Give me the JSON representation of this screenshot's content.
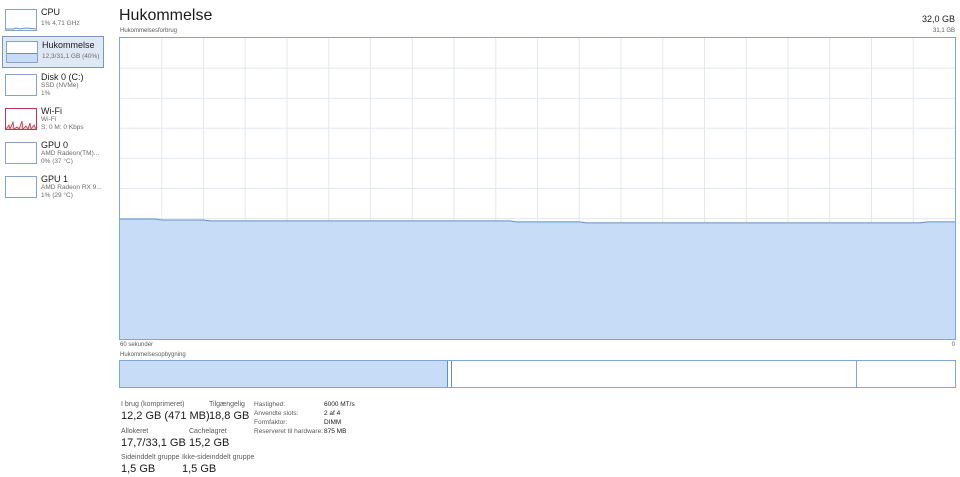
{
  "colors": {
    "memory_fill": "#c7dcf6",
    "memory_line": "#5f8fcf",
    "graph_border": "#7ea7d8",
    "grid": "#e3e8ef",
    "wifi_accent": "#c0354e"
  },
  "sidebar": {
    "items": [
      {
        "title": "CPU",
        "sub1": "1% 4,71 GHz",
        "sub2": "",
        "icon": "cpu-mini-graph"
      },
      {
        "title": "Hukommelse",
        "sub1": "12,3/31,1 GB (40%)",
        "sub2": "",
        "icon": "memory-mini-graph"
      },
      {
        "title": "Disk 0 (C:)",
        "sub1": "SSD (NVMe)",
        "sub2": "1%",
        "icon": "disk-mini-graph"
      },
      {
        "title": "Wi-Fi",
        "sub1": "Wi-Fi",
        "sub2": "S: 0 M: 0 Kbps",
        "icon": "wifi-mini-graph"
      },
      {
        "title": "GPU 0",
        "sub1": "AMD Radeon(TM)...",
        "sub2": "0% (37 °C)",
        "icon": "gpu-mini-graph"
      },
      {
        "title": "GPU 1",
        "sub1": "AMD Radeon RX 9...",
        "sub2": "1% (29 °C)",
        "icon": "gpu-mini-graph"
      }
    ]
  },
  "header": {
    "title": "Hukommelse",
    "total": "32,0 GB"
  },
  "graph": {
    "label": "Hukommelsesforbrug",
    "max_label": "31,1 GB",
    "time_label": "60 sekunder",
    "zero_label": "0",
    "max_gb": 31.1,
    "grid": true,
    "usage_gb": [
      12.4,
      12.4,
      12.4,
      12.4,
      12.4,
      12.4,
      12.3,
      12.3,
      12.3,
      12.3,
      12.3,
      12.3,
      12.3,
      12.2,
      12.2,
      12.2,
      12.2,
      12.2,
      12.2,
      12.2,
      12.2,
      12.2,
      12.2,
      12.2,
      12.2,
      12.2,
      12.2,
      12.2,
      12.2,
      12.2,
      12.2,
      12.2,
      12.2,
      12.2,
      12.2,
      12.2,
      12.2,
      12.2,
      12.2,
      12.2,
      12.2,
      12.2,
      12.2,
      12.2,
      12.2,
      12.2,
      12.2,
      12.2,
      12.2,
      12.2,
      12.2,
      12.2,
      12.2,
      12.2,
      12.2,
      12.2,
      12.2,
      12.1,
      12.1,
      12.1,
      12.1,
      12.1,
      12.1,
      12.1,
      12.1,
      12.1,
      12.1,
      12.0,
      12.0,
      12.0,
      12.0,
      12.0,
      12.0,
      12.0,
      12.0,
      12.0,
      12.0,
      12.0,
      12.0,
      12.0,
      12.0,
      12.0,
      12.0,
      12.0,
      12.0,
      12.0,
      12.0,
      12.0,
      12.0,
      12.0,
      12.0,
      12.0,
      12.0,
      12.0,
      12.0,
      12.0,
      12.0,
      12.0,
      12.0,
      12.0,
      12.0,
      12.0,
      12.0,
      12.0,
      12.0,
      12.0,
      12.0,
      12.0,
      12.0,
      12.0,
      12.0,
      12.0,
      12.0,
      12.0,
      12.0,
      12.0,
      12.1,
      12.1,
      12.1,
      12.1,
      12.1
    ]
  },
  "composition": {
    "label": "Hukommelsesopbygning"
  },
  "stats": {
    "in_use_label": "I brug (komprimeret)",
    "in_use_value": "12,2 GB (471 MB)",
    "available_label": "Tilgængelig",
    "available_value": "18,8 GB",
    "committed_label": "Allokeret",
    "committed_value": "17,7/33,1 GB",
    "cached_label": "Cachelagret",
    "cached_value": "15,2 GB",
    "paged_label": "Sideinddelt gruppe",
    "paged_value": "1,5 GB",
    "nonpaged_label": "Ikke-sideinddelt gruppe",
    "nonpaged_value": "1,5 GB"
  },
  "properties": {
    "speed_label": "Hastighed:",
    "speed_value": "6000 MT/s",
    "slots_label": "Anvendte slots:",
    "slots_value": "2 af 4",
    "form_label": "Formfaktor:",
    "form_value": "DIMM",
    "reserved_label": "Reserveret til hardware:",
    "reserved_value": "875 MB"
  }
}
